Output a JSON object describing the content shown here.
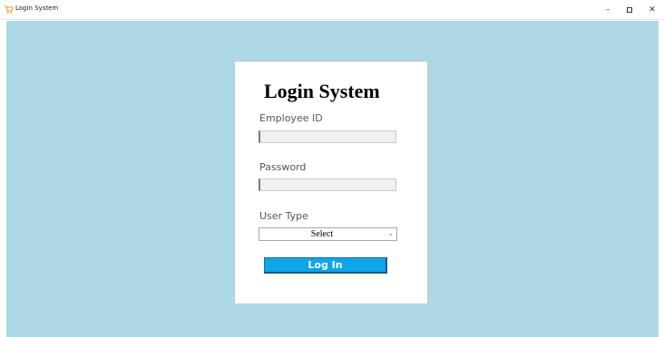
{
  "window": {
    "title": "Login System",
    "icon": "cart-icon",
    "controls": {
      "minimize": "–",
      "maximize": "",
      "close": "✕"
    }
  },
  "colors": {
    "client_background": "#add8e6",
    "button_background": "#0ea5e9",
    "button_text": "#ffffff"
  },
  "login": {
    "heading": "Login System",
    "employee_id_label": "Employee ID",
    "employee_id_value": "",
    "password_label": "Password",
    "password_value": "",
    "user_type_label": "User Type",
    "user_type_selected": "Select",
    "login_button": "Log In"
  }
}
